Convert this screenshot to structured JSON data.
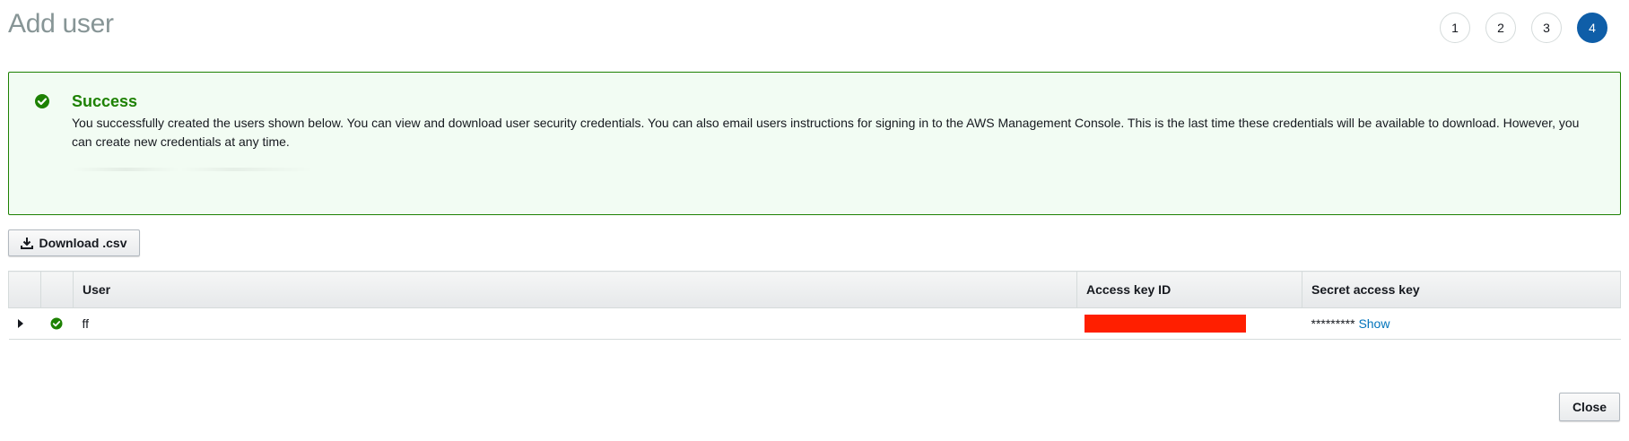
{
  "header": {
    "title": "Add user"
  },
  "steps": [
    "1",
    "2",
    "3",
    "4"
  ],
  "active_step": "4",
  "alert": {
    "title": "Success",
    "body": "You successfully created the users shown below. You can view and download user security credentials. You can also email users instructions for signing in to the AWS Management Console. This is the last time these credentials will be available to download. However, you can create new credentials at any time."
  },
  "toolbar": {
    "download_label": "Download .csv"
  },
  "table": {
    "headers": {
      "user": "User",
      "access_key_id": "Access key ID",
      "secret_access_key": "Secret access key"
    },
    "rows": [
      {
        "user": "ff",
        "secret_masked": "*********",
        "show_label": "Show"
      }
    ]
  },
  "footer": {
    "close_label": "Close"
  },
  "colors": {
    "success": "#1d8102",
    "accent": "#0f5ea8",
    "link": "#0073bb",
    "redaction": "#ff1f00"
  }
}
